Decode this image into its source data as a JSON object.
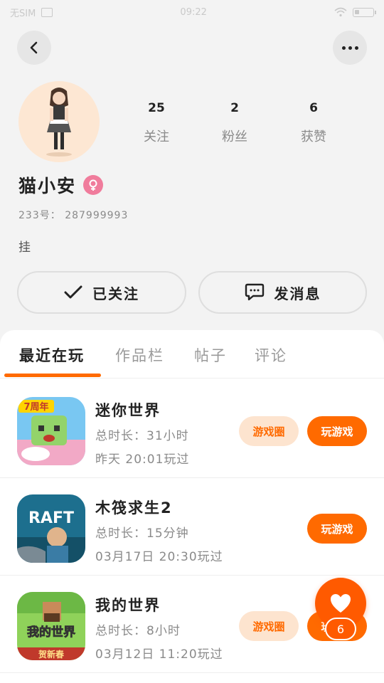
{
  "status_bar": {
    "carrier": "无SIM",
    "time": "09:22"
  },
  "profile": {
    "username": "猫小安",
    "id_label": "233号：",
    "id_value": "287999993",
    "bio": "挂",
    "stats": [
      {
        "value": "25",
        "label": "关注"
      },
      {
        "value": "2",
        "label": "粉丝"
      },
      {
        "value": "6",
        "label": "获赞"
      }
    ]
  },
  "actions": {
    "follow_label": "已关注",
    "message_label": "发消息"
  },
  "tabs": [
    {
      "label": "最近在玩",
      "active": true
    },
    {
      "label": "作品栏",
      "active": false
    },
    {
      "label": "帖子",
      "active": false
    },
    {
      "label": "评论",
      "active": false
    }
  ],
  "games": [
    {
      "title": "迷你世界",
      "duration": "总时长：31小时",
      "last_played": "昨天 20:01玩过",
      "icon_badge": "7周年",
      "circle_label": "游戏圈",
      "play_label": "玩游戏"
    },
    {
      "title": "木筏求生2",
      "duration": "总时长：15分钟",
      "last_played": "03月17日 20:30玩过",
      "icon_badge": "RAFT",
      "play_label": "玩游戏"
    },
    {
      "title": "我的世界",
      "duration": "总时长：8小时",
      "last_played": "03月12日 11:20玩过",
      "icon_badge": "我的世界",
      "icon_sub": "贺新春",
      "circle_label": "游戏圈",
      "play_label": "玩游戏"
    }
  ],
  "like_fab": {
    "count": "6"
  },
  "colors": {
    "accent": "#ff6a00",
    "accent_light": "#fde4cf",
    "gender": "#f07c9c",
    "background": "#f3f3f3"
  },
  "icons": {
    "back": "chevron-left-icon",
    "more": "more-dots-icon",
    "gender": "female-icon",
    "check": "check-icon",
    "message": "chat-bubble-icon",
    "like": "heart-icon"
  }
}
